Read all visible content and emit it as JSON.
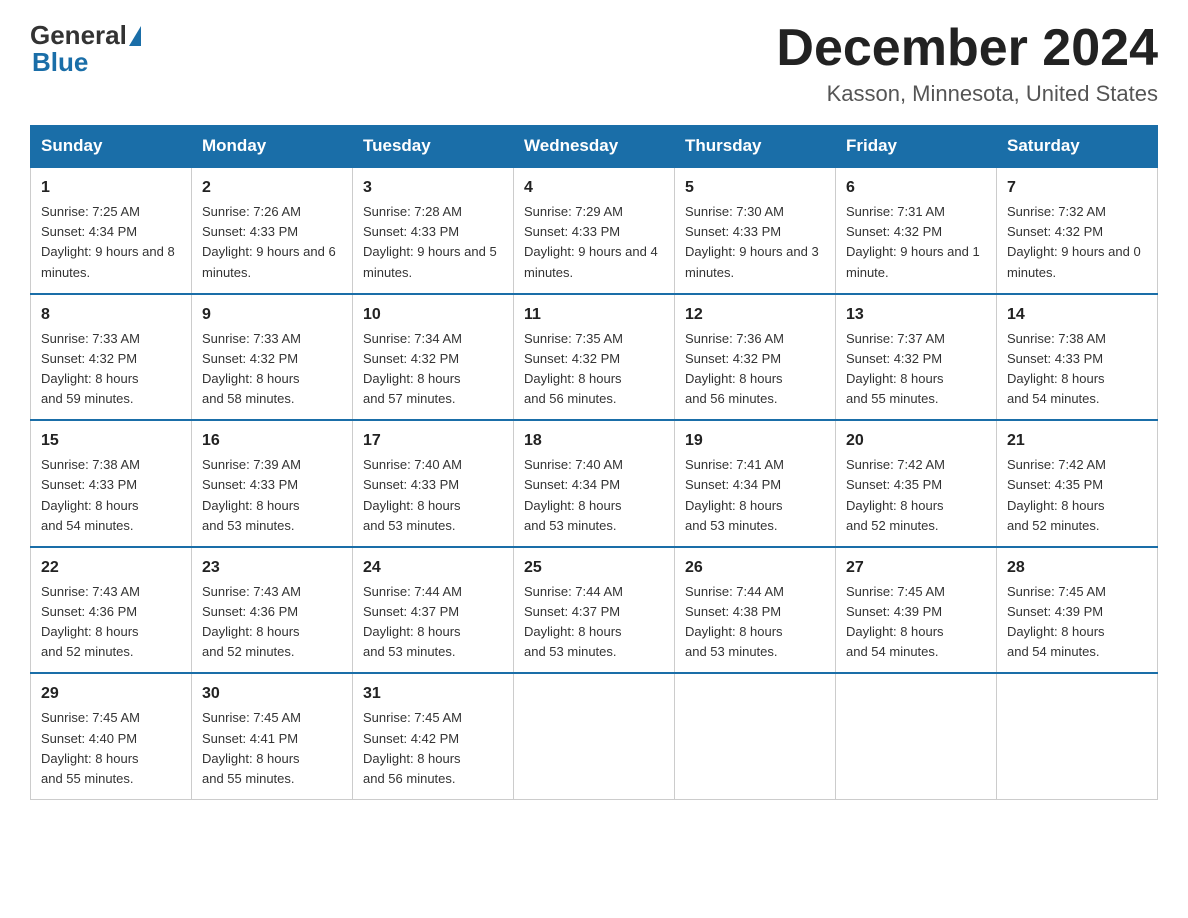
{
  "header": {
    "logo_general": "General",
    "logo_blue": "Blue",
    "month_title": "December 2024",
    "location": "Kasson, Minnesota, United States"
  },
  "days_of_week": [
    "Sunday",
    "Monday",
    "Tuesday",
    "Wednesday",
    "Thursday",
    "Friday",
    "Saturday"
  ],
  "weeks": [
    [
      {
        "day": "1",
        "sunrise": "7:25 AM",
        "sunset": "4:34 PM",
        "daylight": "9 hours and 8 minutes."
      },
      {
        "day": "2",
        "sunrise": "7:26 AM",
        "sunset": "4:33 PM",
        "daylight": "9 hours and 6 minutes."
      },
      {
        "day": "3",
        "sunrise": "7:28 AM",
        "sunset": "4:33 PM",
        "daylight": "9 hours and 5 minutes."
      },
      {
        "day": "4",
        "sunrise": "7:29 AM",
        "sunset": "4:33 PM",
        "daylight": "9 hours and 4 minutes."
      },
      {
        "day": "5",
        "sunrise": "7:30 AM",
        "sunset": "4:33 PM",
        "daylight": "9 hours and 3 minutes."
      },
      {
        "day": "6",
        "sunrise": "7:31 AM",
        "sunset": "4:32 PM",
        "daylight": "9 hours and 1 minute."
      },
      {
        "day": "7",
        "sunrise": "7:32 AM",
        "sunset": "4:32 PM",
        "daylight": "9 hours and 0 minutes."
      }
    ],
    [
      {
        "day": "8",
        "sunrise": "7:33 AM",
        "sunset": "4:32 PM",
        "daylight": "8 hours and 59 minutes."
      },
      {
        "day": "9",
        "sunrise": "7:33 AM",
        "sunset": "4:32 PM",
        "daylight": "8 hours and 58 minutes."
      },
      {
        "day": "10",
        "sunrise": "7:34 AM",
        "sunset": "4:32 PM",
        "daylight": "8 hours and 57 minutes."
      },
      {
        "day": "11",
        "sunrise": "7:35 AM",
        "sunset": "4:32 PM",
        "daylight": "8 hours and 56 minutes."
      },
      {
        "day": "12",
        "sunrise": "7:36 AM",
        "sunset": "4:32 PM",
        "daylight": "8 hours and 56 minutes."
      },
      {
        "day": "13",
        "sunrise": "7:37 AM",
        "sunset": "4:32 PM",
        "daylight": "8 hours and 55 minutes."
      },
      {
        "day": "14",
        "sunrise": "7:38 AM",
        "sunset": "4:33 PM",
        "daylight": "8 hours and 54 minutes."
      }
    ],
    [
      {
        "day": "15",
        "sunrise": "7:38 AM",
        "sunset": "4:33 PM",
        "daylight": "8 hours and 54 minutes."
      },
      {
        "day": "16",
        "sunrise": "7:39 AM",
        "sunset": "4:33 PM",
        "daylight": "8 hours and 53 minutes."
      },
      {
        "day": "17",
        "sunrise": "7:40 AM",
        "sunset": "4:33 PM",
        "daylight": "8 hours and 53 minutes."
      },
      {
        "day": "18",
        "sunrise": "7:40 AM",
        "sunset": "4:34 PM",
        "daylight": "8 hours and 53 minutes."
      },
      {
        "day": "19",
        "sunrise": "7:41 AM",
        "sunset": "4:34 PM",
        "daylight": "8 hours and 53 minutes."
      },
      {
        "day": "20",
        "sunrise": "7:42 AM",
        "sunset": "4:35 PM",
        "daylight": "8 hours and 52 minutes."
      },
      {
        "day": "21",
        "sunrise": "7:42 AM",
        "sunset": "4:35 PM",
        "daylight": "8 hours and 52 minutes."
      }
    ],
    [
      {
        "day": "22",
        "sunrise": "7:43 AM",
        "sunset": "4:36 PM",
        "daylight": "8 hours and 52 minutes."
      },
      {
        "day": "23",
        "sunrise": "7:43 AM",
        "sunset": "4:36 PM",
        "daylight": "8 hours and 52 minutes."
      },
      {
        "day": "24",
        "sunrise": "7:44 AM",
        "sunset": "4:37 PM",
        "daylight": "8 hours and 53 minutes."
      },
      {
        "day": "25",
        "sunrise": "7:44 AM",
        "sunset": "4:37 PM",
        "daylight": "8 hours and 53 minutes."
      },
      {
        "day": "26",
        "sunrise": "7:44 AM",
        "sunset": "4:38 PM",
        "daylight": "8 hours and 53 minutes."
      },
      {
        "day": "27",
        "sunrise": "7:45 AM",
        "sunset": "4:39 PM",
        "daylight": "8 hours and 54 minutes."
      },
      {
        "day": "28",
        "sunrise": "7:45 AM",
        "sunset": "4:39 PM",
        "daylight": "8 hours and 54 minutes."
      }
    ],
    [
      {
        "day": "29",
        "sunrise": "7:45 AM",
        "sunset": "4:40 PM",
        "daylight": "8 hours and 55 minutes."
      },
      {
        "day": "30",
        "sunrise": "7:45 AM",
        "sunset": "4:41 PM",
        "daylight": "8 hours and 55 minutes."
      },
      {
        "day": "31",
        "sunrise": "7:45 AM",
        "sunset": "4:42 PM",
        "daylight": "8 hours and 56 minutes."
      },
      null,
      null,
      null,
      null
    ]
  ],
  "labels": {
    "sunrise": "Sunrise:",
    "sunset": "Sunset:",
    "daylight": "Daylight:"
  }
}
